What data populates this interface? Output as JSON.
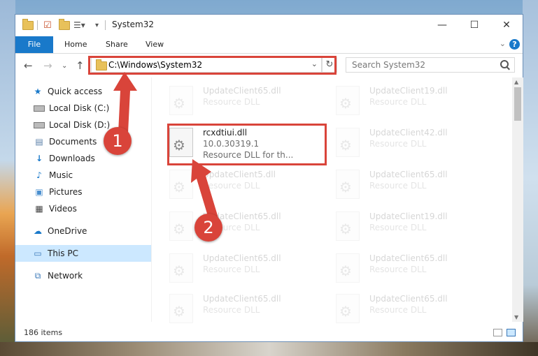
{
  "window": {
    "title": "System32"
  },
  "ribbon": {
    "file": "File",
    "home": "Home",
    "share": "Share",
    "view": "View",
    "help": "?"
  },
  "address": {
    "path": "C:\\Windows\\System32"
  },
  "search": {
    "placeholder": "Search System32"
  },
  "sidebar": {
    "items": [
      {
        "label": "Quick access",
        "icon": "star-icon"
      },
      {
        "label": "Local Disk (C:)",
        "icon": "drive-icon"
      },
      {
        "label": "Local Disk (D:)",
        "icon": "drive-icon"
      },
      {
        "label": "Documents",
        "icon": "documents-icon"
      },
      {
        "label": "Downloads",
        "icon": "downloads-icon"
      },
      {
        "label": "Music",
        "icon": "music-icon"
      },
      {
        "label": "Pictures",
        "icon": "pictures-icon"
      },
      {
        "label": "Videos",
        "icon": "videos-icon"
      },
      {
        "label": "OneDrive",
        "icon": "cloud-icon"
      },
      {
        "label": "This PC",
        "icon": "computer-icon"
      },
      {
        "label": "Network",
        "icon": "network-icon"
      }
    ]
  },
  "files": [
    {
      "name": "UpdateClient65.dll",
      "desc": "Resource DLL"
    },
    {
      "name": "UpdateClient19.dll",
      "desc": "Resource DLL"
    },
    {
      "name": "rcxdtiui.dll",
      "version": "10.0.30319.1",
      "desc": "Resource DLL for th..."
    },
    {
      "name": "UpdateClient42.dll",
      "desc": "Resource DLL"
    },
    {
      "name": "UpdateClient5.dll",
      "desc": "Resource DLL"
    },
    {
      "name": "UpdateClient65.dll",
      "desc": "Resource DLL"
    },
    {
      "name": "UpdateClient65.dll",
      "desc": "Resource DLL"
    },
    {
      "name": "UpdateClient19.dll",
      "desc": "Resource DLL"
    },
    {
      "name": "UpdateClient65.dll",
      "desc": "Resource DLL"
    },
    {
      "name": "UpdateClient65.dll",
      "desc": "Resource DLL"
    },
    {
      "name": "UpdateClient65.dll",
      "desc": "Resource DLL"
    },
    {
      "name": "UpdateClient65.dll",
      "desc": "Resource DLL"
    }
  ],
  "status": {
    "count": "186 items"
  },
  "annotations": {
    "step1": "1",
    "step2": "2",
    "color": "#d9443a"
  },
  "colors": {
    "accent": "#1979ca",
    "selection": "#cce8ff"
  }
}
